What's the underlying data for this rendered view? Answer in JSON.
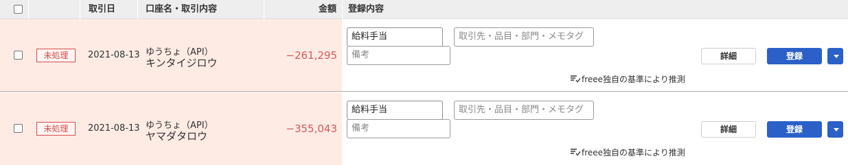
{
  "header": {
    "date": "取引日",
    "account_desc": "口座名・取引内容",
    "amount": "金額",
    "registration": "登録内容"
  },
  "rows": [
    {
      "status": "未処理",
      "date": "2021-08-13",
      "account": "ゆうちょ（API）",
      "description": "キンタイジロウ",
      "amount": "−261,295",
      "item_value": "給料手当",
      "tag_placeholder": "取引先・品目・部門・メモタグ",
      "memo_placeholder": "備考",
      "detail_label": "詳細",
      "save_label": "登録",
      "guess_text": "freee独自の基準により推測"
    },
    {
      "status": "未処理",
      "date": "2021-08-13",
      "account": "ゆうちょ（API）",
      "description": "ヤマダタロウ",
      "amount": "−355,043",
      "item_value": "給料手当",
      "tag_placeholder": "取引先・品目・部門・メモタグ",
      "memo_placeholder": "備考",
      "detail_label": "詳細",
      "save_label": "登録",
      "guess_text": "freee独自の基準により推測"
    }
  ],
  "colors": {
    "unprocessed_row_bg": "#fdebe4",
    "status_badge": "#d84b4b",
    "negative_amount": "#d55b5b",
    "primary_button": "#2a60c8"
  },
  "icons": {
    "guess": "sort-check-icon",
    "dropdown": "caret-down-icon"
  }
}
